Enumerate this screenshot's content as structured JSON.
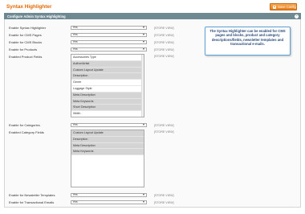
{
  "header": {
    "title": "Syntax Highlighter",
    "save_label": "Save Config"
  },
  "section": {
    "title": "Configure Admin Syntax Highlighting"
  },
  "scope_label": "[STORE VIEW]",
  "rows": [
    {
      "label": "Enable Syntax Highlighter",
      "value": "Yes"
    },
    {
      "label": "Enable for CMS Pages",
      "value": "Yes"
    },
    {
      "label": "Enable for CMS Blocks",
      "value": "Yes"
    },
    {
      "label": "Enable for Products",
      "value": "Yes"
    }
  ],
  "product_fields": {
    "label": "Enabled Product Fields",
    "options": [
      {
        "text": "Accessories Type",
        "selected": false
      },
      {
        "text": "Author/Artist",
        "selected": false
      },
      {
        "text": "Custom Layout Update",
        "selected": true
      },
      {
        "text": "Description",
        "selected": true
      },
      {
        "text": "Genre",
        "selected": false
      },
      {
        "text": "Luggage Style",
        "selected": false
      },
      {
        "text": "Meta Description",
        "selected": true
      },
      {
        "text": "Meta Keywords",
        "selected": true
      },
      {
        "text": "Short Description",
        "selected": true
      },
      {
        "text": "Width",
        "selected": false
      }
    ]
  },
  "categories": {
    "label": "Enable for Categories",
    "value": "Yes"
  },
  "category_fields": {
    "label": "Enabled Category Fields",
    "options": [
      {
        "text": "Custom Layout Update",
        "selected": true
      },
      {
        "text": "Description",
        "selected": true
      },
      {
        "text": "Meta Description",
        "selected": true
      },
      {
        "text": "Meta Keywords",
        "selected": true
      }
    ]
  },
  "newsletter": {
    "label": "Enable for Newsletter Templates",
    "value": "Yes"
  },
  "transactional": {
    "label": "Enable for Transactional Emails",
    "value": "Yes"
  },
  "tooltip": "The Syntax Highlighter can be enabled for CMS pages and blocks, product and category descriptions/fields, newsletter templates and transactional e-mails.",
  "colors": {
    "title": "#e26703",
    "save_button": "#e57e1f",
    "section_header": "#6f8992",
    "tooltip_border": "#5ea1d6"
  }
}
